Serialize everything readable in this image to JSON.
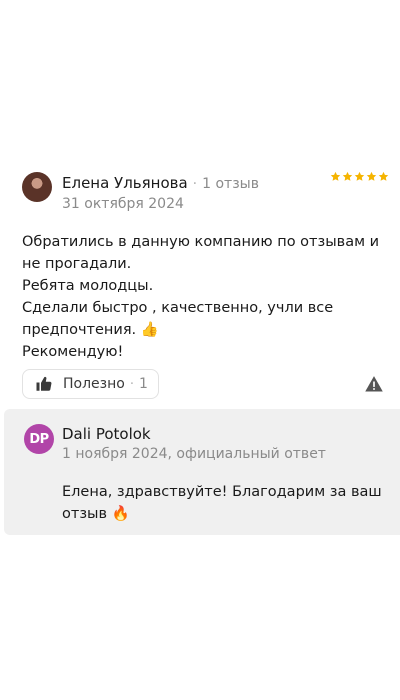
{
  "review": {
    "author": {
      "name": "Елена Ульянова",
      "review_count": "1 отзыв",
      "date": "31 октября 2024"
    },
    "rating": 5,
    "text": "Обратились в данную компанию по отзывам и\nне прогадали.\nРебята молодцы.\nСделали быстро , качественно, учли все\nпредпочтения. 👍\nРекомендую!",
    "helpful": {
      "label": "Полезно",
      "separator": "·",
      "count": "1"
    },
    "separator": "·"
  },
  "reply": {
    "avatar_initials": "DP",
    "avatar_color": "#b145a8",
    "name": "Dali Potolok",
    "meta": "1 ноября 2024, официальный ответ",
    "text": "Елена, здравствуйте! Благодарим за ваш\nотзыв 🔥"
  },
  "colors": {
    "star": "#f5b400",
    "muted": "#8a8a8a",
    "reply_bg": "#f0f0f0"
  },
  "icons": {
    "helpful": "thumbs-up-icon",
    "report": "warning-icon",
    "rating": "star-icon"
  }
}
